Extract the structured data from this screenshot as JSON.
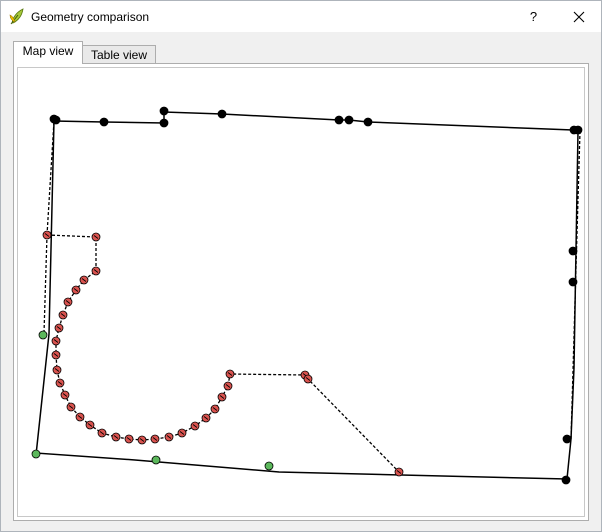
{
  "window": {
    "title": "Geometry comparison",
    "help_label": "?",
    "close_label": "✕"
  },
  "tabs": [
    {
      "label": "Map view",
      "active": true
    },
    {
      "label": "Table view",
      "active": false
    }
  ],
  "colors": {
    "common_vertex": "#000000",
    "removed_vertex": "#d9534f",
    "added_vertex": "#5cb85c",
    "line": "#000000"
  },
  "icons": {
    "app": "qgis-leaf-icon",
    "help": "question-icon",
    "close": "close-icon"
  }
}
